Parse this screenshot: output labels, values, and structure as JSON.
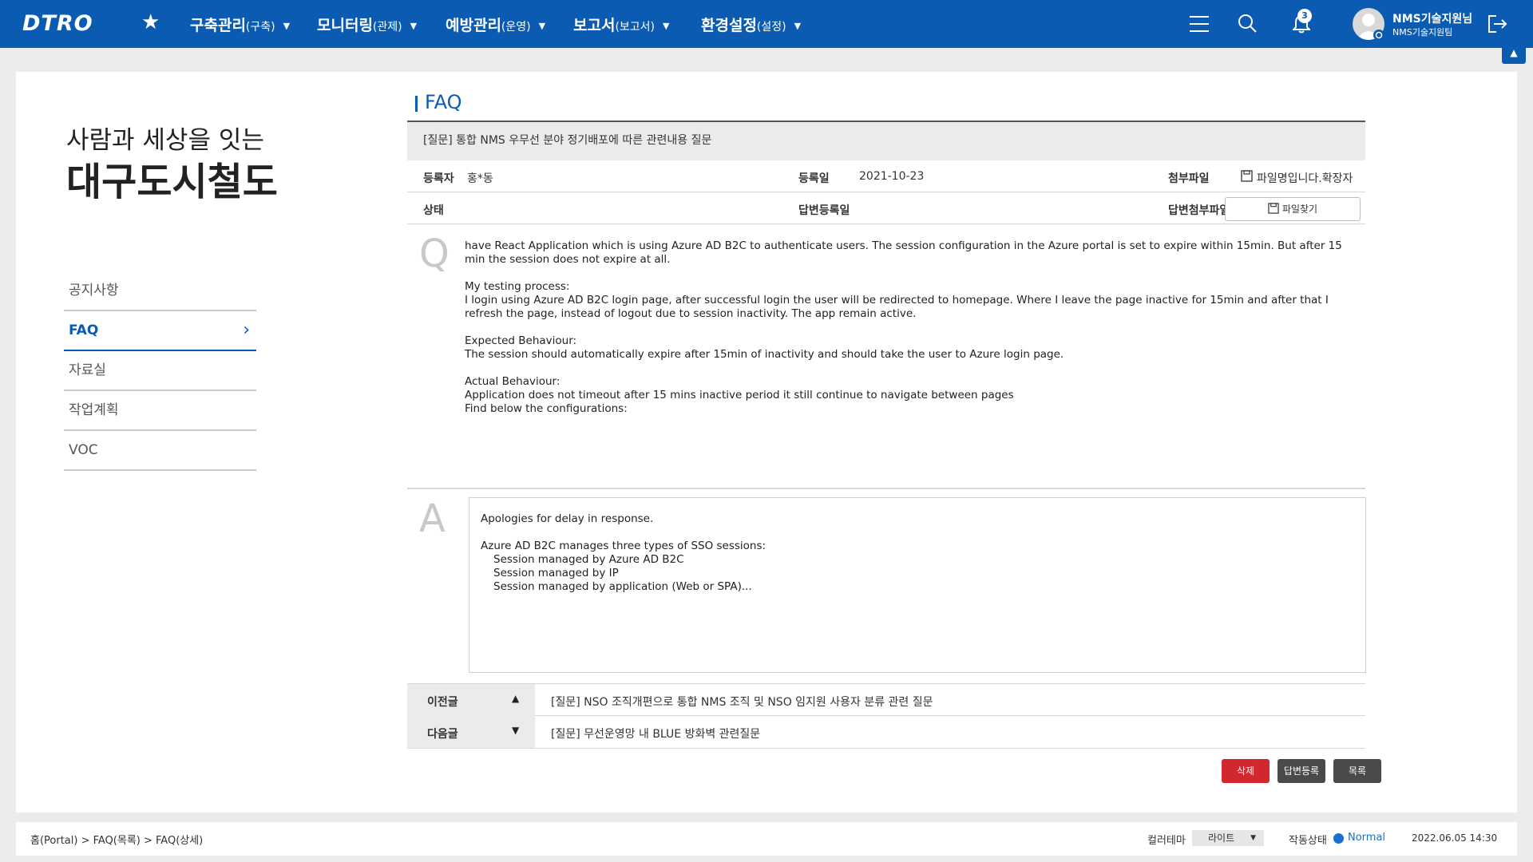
{
  "topbar": {
    "logo": "DTRO",
    "menus": [
      {
        "label": "구축관리",
        "sub": "(구축)"
      },
      {
        "label": "모니터링",
        "sub": "(관제)"
      },
      {
        "label": "예방관리",
        "sub": "(운영)"
      },
      {
        "label": "보고서",
        "sub": "(보고서)"
      },
      {
        "label": "환경설정",
        "sub": "(설정)"
      }
    ],
    "notification_count": "3",
    "user_name": "NMS기술지원님",
    "user_team": "NMS기술지원팀"
  },
  "slogan": {
    "line1": "사람과 세상을 잇는",
    "line2": "대구도시철도"
  },
  "side_nav": {
    "items": [
      {
        "label": "공지사항"
      },
      {
        "label": "FAQ"
      },
      {
        "label": "자료실"
      },
      {
        "label": "작업계획"
      },
      {
        "label": "VOC"
      }
    ]
  },
  "faq": {
    "section_title": "FAQ",
    "subject": "[질문] 통합 NMS 우무선 분야 정기배포에 따른 관련내용 질문",
    "registrant_label": "등록자",
    "registrant": "홍*동",
    "reg_date_label": "등록일",
    "reg_date": "2021-10-23",
    "attach_label": "첨부파일",
    "attach_name": "파일명입니다.확장자",
    "status_label": "상태",
    "answer_date_label": "답변등록일",
    "answer_attach_label": "답변첨부파일",
    "find_file_button": "파일찾기",
    "question_letter": "Q",
    "question": {
      "p1": " have React Application which is using Azure AD B2C to authenticate users. The session configuration in the Azure portal is set to expire within 15min. But after 15 min the session does not expire at all.",
      "p2_title": "My testing process:",
      "p2_body": "I login using Azure AD B2C login page, after successful login the user will be redirected to homepage. Where I leave the page inactive for 15min and after that I refresh the page, instead of logout due to session inactivity. The app remain active.",
      "p3_title": "Expected Behaviour:",
      "p3_body": "The session should automatically expire after 15min of inactivity and should take the user to Azure login page.",
      "p4_title": "Actual Behaviour:",
      "p4_body1": "Application does not timeout after 15 mins inactive period it still continue to navigate between pages",
      "p4_body2": "Find below the configurations:"
    },
    "answer_letter": "A",
    "answer": {
      "p1": "Apologies for delay in response.",
      "p2": "Azure AD B2C manages three types of SSO sessions:",
      "i1": "Session managed by Azure AD B2C",
      "i2": "Session managed by IP",
      "i3": "Session managed by application (Web or SPA)..."
    },
    "prev_label": "이전글",
    "prev_title": "[질문] NSO 조직개편으로 통합 NMS 조직 및 NSO 임지원 사용자 분류 관련 질문",
    "next_label": "다음글",
    "next_title": "[질문] 무선운영망 내 BLUE 방화벽 관련질문",
    "buttons": {
      "delete": "삭제",
      "reply": "답변등록",
      "list": "목록"
    }
  },
  "footer": {
    "breadcrumb": "홈(Portal) > FAQ(목록) > FAQ(상세)",
    "theme_label": "컬러테마",
    "theme_value": "라이트",
    "status_label": "작동상태",
    "status_value": "Normal",
    "datetime": "2022.06.05 14:30"
  },
  "colors": {
    "primary": "#0a5bb1",
    "delete": "#d0282e",
    "dark_button": "#4a4a4a"
  },
  "icons": [
    "star-icon",
    "hamburger-icon",
    "search-icon",
    "bell-icon",
    "settings-icon",
    "logout-icon",
    "chevron-right-icon",
    "file-icon",
    "caret-up-icon",
    "caret-down-icon"
  ]
}
